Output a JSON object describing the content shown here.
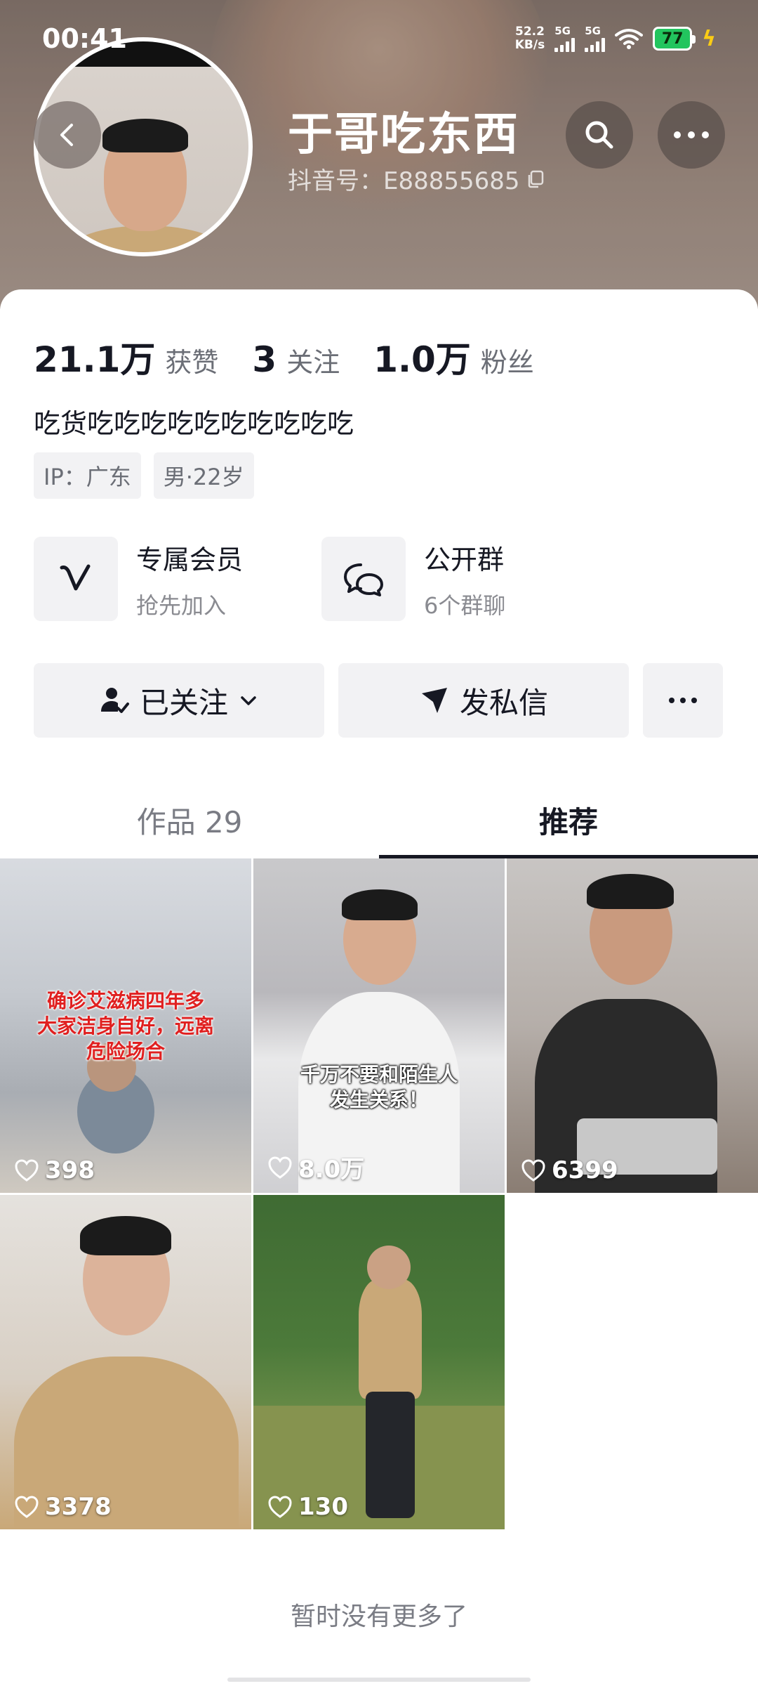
{
  "status_bar": {
    "time": "00:41",
    "net_speed": "52.2",
    "net_unit": "KB/s",
    "sim1": "5G",
    "sim2": "5G",
    "battery": "77"
  },
  "header": {
    "nickname": "于哥吃东西",
    "douyin_id": "抖音号：E88855685"
  },
  "stats": [
    {
      "value": "21.1万",
      "label": "获赞"
    },
    {
      "value": "3",
      "label": "关注"
    },
    {
      "value": "1.0万",
      "label": "粉丝"
    }
  ],
  "bio": "吃货吃吃吃吃吃吃吃吃吃吃",
  "tags": [
    "IP：广东",
    "男·22岁"
  ],
  "features": [
    {
      "title": "专属会员",
      "sub": "抢先加入",
      "icon": "vip-v-icon"
    },
    {
      "title": "公开群",
      "sub": "6个群聊",
      "icon": "group-chat-icon"
    }
  ],
  "actions": {
    "follow": "已关注",
    "message": "发私信"
  },
  "tabs": {
    "works": "作品 29",
    "recommend": "推荐"
  },
  "videos": [
    {
      "likes": "398",
      "caption": "确诊艾滋病四年多\n大家洁身自好，远离\n危险场合"
    },
    {
      "likes": "8.0万",
      "caption": "千万不要和陌生人\n发生关系！"
    },
    {
      "likes": "6399",
      "caption": ""
    },
    {
      "likes": "3378",
      "caption": ""
    },
    {
      "likes": "130",
      "caption": ""
    }
  ],
  "footer": {
    "no_more": "暂时没有更多了"
  }
}
